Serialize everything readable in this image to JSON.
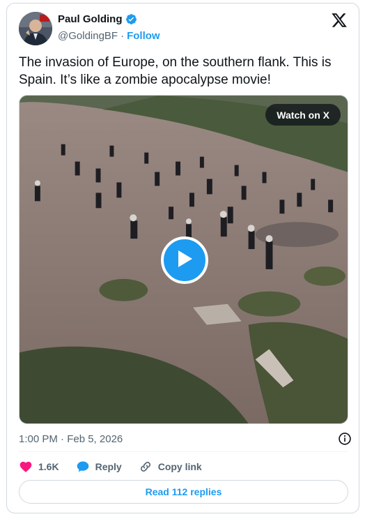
{
  "author": {
    "name": "Paul Golding",
    "handle": "@GoldingBF",
    "separator": "·",
    "follow_label": "Follow"
  },
  "tweet": {
    "text": "The invasion of Europe, on the southern flank. This is Spain. It’s like a zombie apocalypse movie!"
  },
  "media": {
    "watch_label": "Watch on X"
  },
  "meta": {
    "timestamp": "1:00 PM · Feb 5, 2026"
  },
  "actions": {
    "like_count": "1.6K",
    "reply_label": "Reply",
    "copy_link_label": "Copy link"
  },
  "footer": {
    "read_replies_label": "Read 112 replies"
  },
  "colors": {
    "accent": "#1d9bf0",
    "like": "#f91880",
    "text_secondary": "#536471"
  }
}
